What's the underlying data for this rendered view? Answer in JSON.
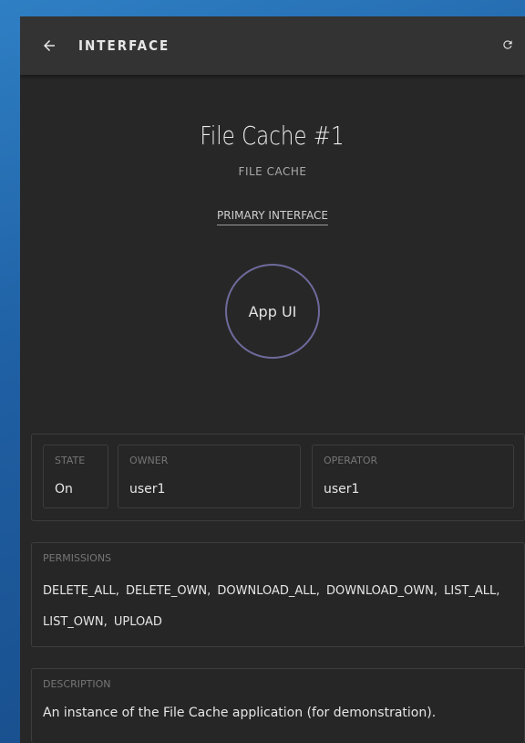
{
  "topbar": {
    "title": "INTERFACE",
    "back_icon": "arrow-left-icon",
    "refresh_icon": "refresh-icon"
  },
  "app": {
    "name": "File Cache #1",
    "type": "FILE CACHE",
    "interface_link": "PRIMARY INTERFACE",
    "app_ui_label": "App UI"
  },
  "properties": {
    "state_label": "STATE",
    "state_value": "On",
    "owner_label": "OWNER",
    "owner_value": "user1",
    "operator_label": "OPERATOR",
    "operator_value": "user1"
  },
  "permissions": {
    "label": "PERMISSIONS",
    "text": "DELETE_ALL, DELETE_OWN, DOWNLOAD_ALL, DOWNLOAD_OWN, LIST_ALL, LIST_OWN, UPLOAD"
  },
  "description": {
    "label": "DESCRIPTION",
    "text": "An instance of the File Cache application (for demonstration)."
  },
  "colors": {
    "accent_ring": "#6e6a9c",
    "panel_bg": "#272727",
    "topbar_bg": "#333333"
  }
}
